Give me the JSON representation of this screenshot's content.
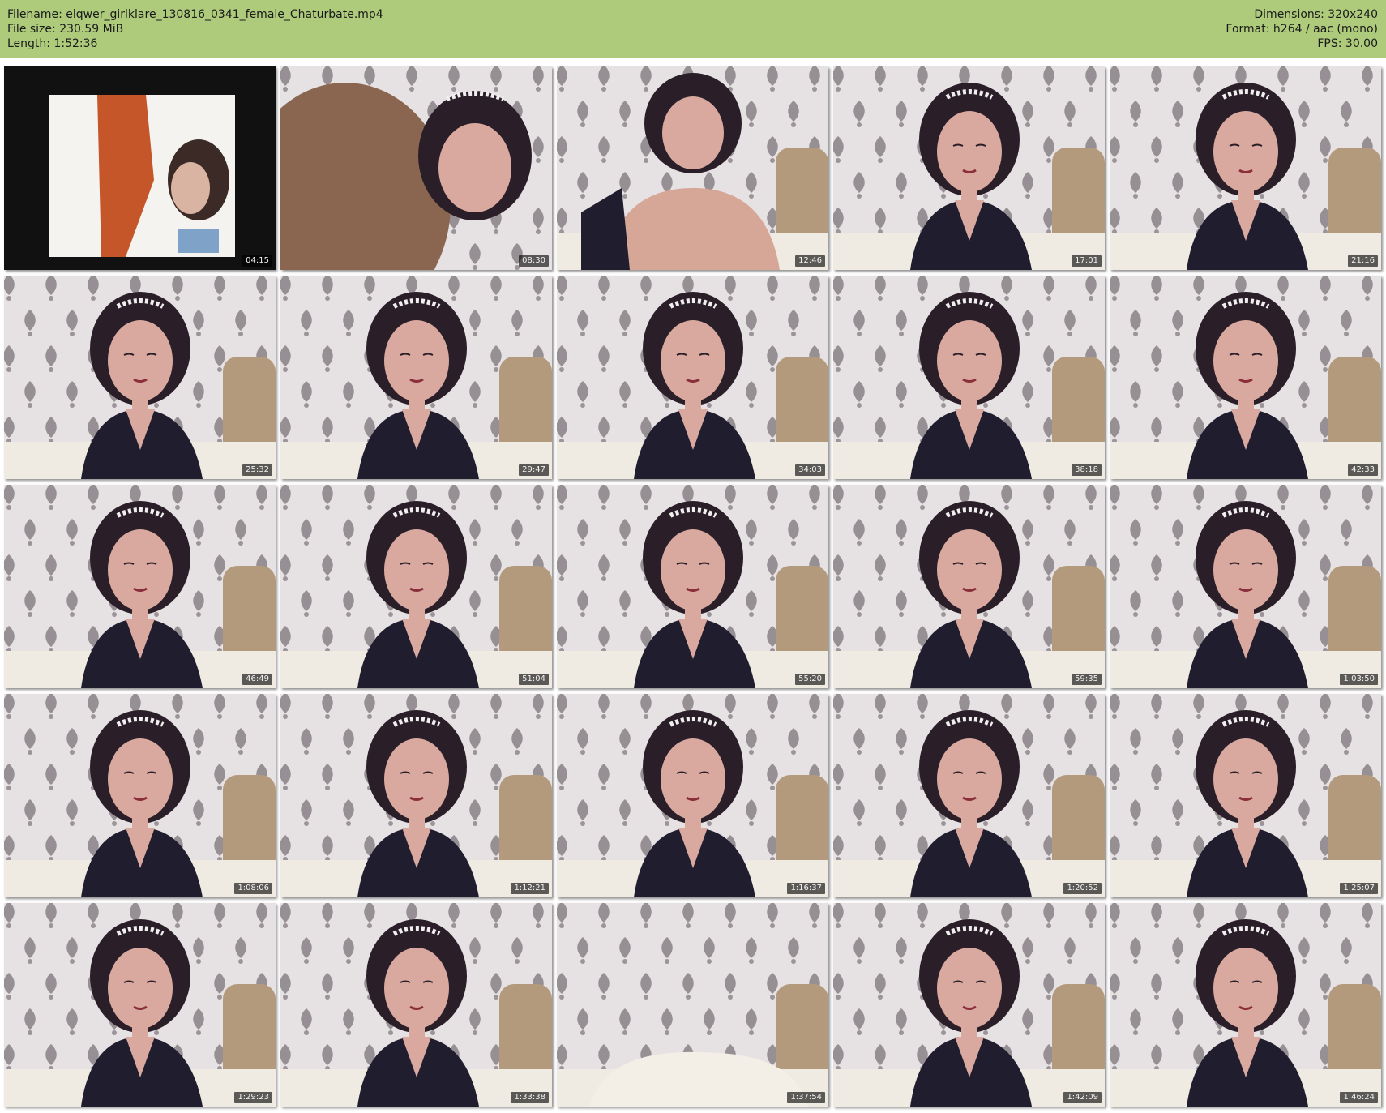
{
  "header": {
    "filename": "Filename: elqwer_girlklare_130816_0341_female_Chaturbate.mp4",
    "filesize": "File size: 230.59 MiB",
    "length": "Length: 1:52:36",
    "dimensions": "Dimensions: 320x240",
    "format": "Format: h264 / aac (mono)",
    "fps": "FPS: 30.00"
  },
  "colors": {
    "header_bg": "#aecb7c",
    "wallpaper": "#e6e1e3",
    "damask": "#7b7479",
    "coat": "#1f1d2e",
    "hair": "#2a1f28",
    "skin": "#d9a9a0"
  },
  "thumbnails": [
    {
      "timestamp": "04:15",
      "scene": "tv"
    },
    {
      "timestamp": "08:30",
      "scene": "closeup"
    },
    {
      "timestamp": "12:46",
      "scene": "bare"
    },
    {
      "timestamp": "17:01",
      "scene": "coat"
    },
    {
      "timestamp": "21:16",
      "scene": "coat"
    },
    {
      "timestamp": "25:32",
      "scene": "coat"
    },
    {
      "timestamp": "29:47",
      "scene": "coat"
    },
    {
      "timestamp": "34:03",
      "scene": "coat"
    },
    {
      "timestamp": "38:18",
      "scene": "coat"
    },
    {
      "timestamp": "42:33",
      "scene": "coat"
    },
    {
      "timestamp": "46:49",
      "scene": "coat"
    },
    {
      "timestamp": "51:04",
      "scene": "coat"
    },
    {
      "timestamp": "55:20",
      "scene": "coat"
    },
    {
      "timestamp": "59:35",
      "scene": "coat"
    },
    {
      "timestamp": "1:03:50",
      "scene": "coat"
    },
    {
      "timestamp": "1:08:06",
      "scene": "coat"
    },
    {
      "timestamp": "1:12:21",
      "scene": "coat"
    },
    {
      "timestamp": "1:16:37",
      "scene": "coat"
    },
    {
      "timestamp": "1:20:52",
      "scene": "coat"
    },
    {
      "timestamp": "1:25:07",
      "scene": "coat"
    },
    {
      "timestamp": "1:29:23",
      "scene": "coat"
    },
    {
      "timestamp": "1:33:38",
      "scene": "coat"
    },
    {
      "timestamp": "1:37:54",
      "scene": "empty"
    },
    {
      "timestamp": "1:42:09",
      "scene": "coat"
    },
    {
      "timestamp": "1:46:24",
      "scene": "coat"
    }
  ]
}
